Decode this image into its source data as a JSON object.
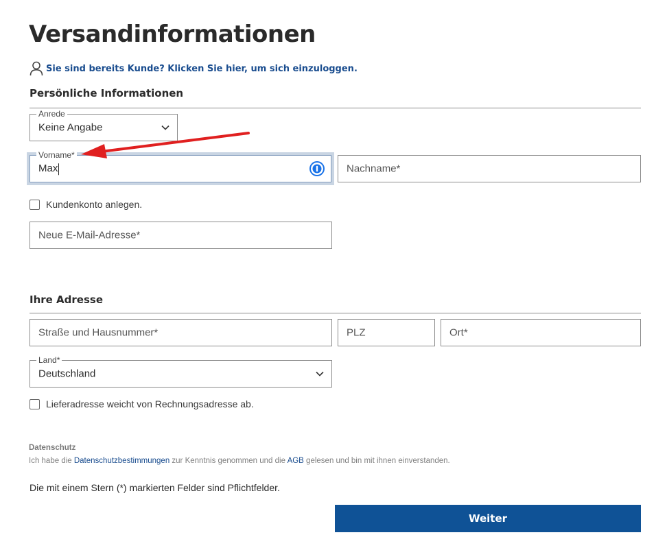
{
  "page": {
    "title": "Versandinformationen"
  },
  "login": {
    "icon": "user-icon",
    "link_text": "Sie sind bereits Kunde? Klicken Sie hier, um sich einzuloggen."
  },
  "personal": {
    "heading": "Persönliche Informationen",
    "salutation": {
      "label": "Anrede",
      "value": "Keine Angabe"
    },
    "first_name": {
      "label": "Vorname*",
      "value": "Max"
    },
    "last_name": {
      "placeholder": "Nachname*"
    },
    "create_account": {
      "label": "Kundenkonto anlegen.",
      "checked": false
    },
    "email": {
      "placeholder": "Neue E-Mail-Adresse*"
    }
  },
  "address": {
    "heading": "Ihre Adresse",
    "street": {
      "placeholder": "Straße und Hausnummer*"
    },
    "zip": {
      "placeholder": "PLZ"
    },
    "city": {
      "placeholder": "Ort*"
    },
    "country": {
      "label": "Land*",
      "value": "Deutschland"
    },
    "different_delivery": {
      "label": "Lieferadresse weicht von Rechnungsadresse ab.",
      "checked": false
    }
  },
  "privacy": {
    "heading": "Datenschutz",
    "text_before": "Ich habe die ",
    "privacy_link": "Datenschutzbestimmungen",
    "text_middle": " zur Kenntnis genommen und die ",
    "agb_link": "AGB",
    "text_after": " gelesen und bin mit ihnen einverstanden."
  },
  "required_note": "Die mit einem Stern (*) markierten Felder sind Pflichtfelder.",
  "submit": {
    "label": "Weiter"
  },
  "colors": {
    "accent": "#0f5296",
    "link": "#1a4d8f",
    "annotation_arrow": "#e02020",
    "password_manager": "#1a73e8"
  }
}
